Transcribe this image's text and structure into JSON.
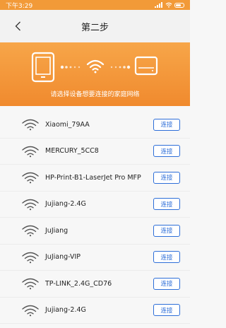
{
  "status": {
    "time": "下午3:29",
    "battery_level": 0.6
  },
  "nav": {
    "title": "第二步"
  },
  "banner": {
    "text": "请选择设备想要连接的家庭网络"
  },
  "networks": [
    {
      "ssid": "Xiaomi_79AA",
      "action": "连接"
    },
    {
      "ssid": "MERCURY_5CC8",
      "action": "连接"
    },
    {
      "ssid": "HP-Print-B1-LaserJet Pro MFP",
      "action": "连接"
    },
    {
      "ssid": "Jujiang-2.4G",
      "action": "连接"
    },
    {
      "ssid": "JuJiang",
      "action": "连接"
    },
    {
      "ssid": "JuJiang-VIP",
      "action": "连接"
    },
    {
      "ssid": "TP-LINK_2.4G_CD76",
      "action": "连接"
    },
    {
      "ssid": "Jujiang-2.4G",
      "action": "连接"
    }
  ],
  "colors": {
    "accent": "#f29a38",
    "link": "#2d6ed8"
  }
}
